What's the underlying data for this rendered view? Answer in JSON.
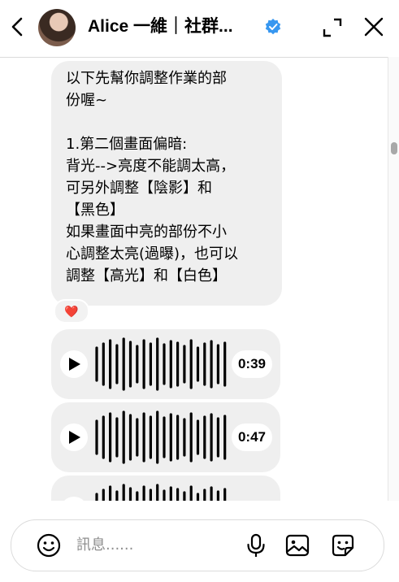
{
  "header": {
    "title": "Alice 一維｜社群...",
    "verified_color": "#3797f0"
  },
  "messages": {
    "text_message": "以下先幫你調整作業的部\n份喔~\n\n1.第二個畫面偏暗:\n背光-->亮度不能調太高，\n可另外調整【陰影】和\n【黑色】\n如果畫面中亮的部份不小\n心調整太亮(過曝)，也可以\n調整【高光】和【白色】",
    "reaction": "❤️",
    "voice_messages": [
      {
        "duration": "0:39"
      },
      {
        "duration": "0:47"
      },
      {
        "duration": ""
      }
    ]
  },
  "composer": {
    "placeholder": "訊息......"
  },
  "icons": {
    "back": "chevron-left-icon",
    "expand": "expand-icon",
    "close": "close-icon",
    "emoji": "emoji-icon",
    "mic": "microphone-icon",
    "image": "image-icon",
    "sticker": "sticker-icon"
  }
}
